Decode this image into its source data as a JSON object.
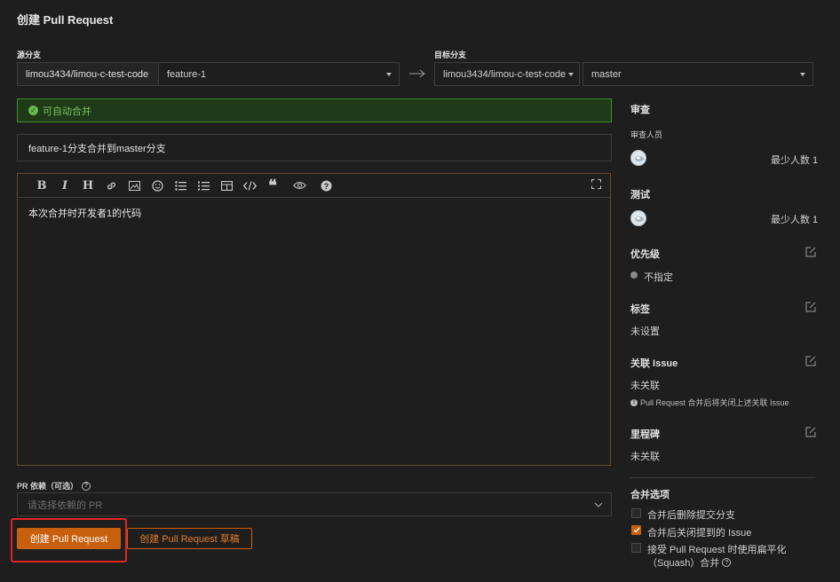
{
  "page": {
    "title": "创建 Pull Request"
  },
  "source": {
    "label": "源分支",
    "repo": "limou3434/limou-c-test-code",
    "branch": "feature-1"
  },
  "target": {
    "label": "目标分支",
    "repo": "limou3434/limou-c-test-code",
    "branch": "master"
  },
  "merge_status": {
    "text": "可自动合并",
    "color": "#74c45b"
  },
  "form": {
    "title_value": "feature-1分支合并到master分支",
    "body_value": "本次合并时开发者1的代码",
    "dependency_label": "PR 依赖（可选）",
    "dependency_placeholder": "请选择依赖的 PR"
  },
  "toolbar": [
    "bold-icon",
    "italic-icon",
    "heading-icon",
    "link-icon",
    "image-icon",
    "emoji-icon",
    "bullet-list-icon",
    "numbered-list-icon",
    "table-icon",
    "code-icon",
    "quote-icon",
    "preview-icon",
    "help-icon",
    "fullscreen-icon"
  ],
  "buttons": {
    "create": "创建 Pull Request",
    "create_draft": "创建 Pull Request 草稿"
  },
  "sidebar": {
    "review": {
      "heading": "审查",
      "sub": "审查人员",
      "min": "最少人数 1"
    },
    "test": {
      "heading": "测试",
      "min": "最少人数 1"
    },
    "priority": {
      "heading": "优先级",
      "value": "不指定"
    },
    "labels": {
      "heading": "标签",
      "value": "未设置"
    },
    "issue": {
      "heading": "关联 Issue",
      "value": "未关联",
      "note": "Pull Request 合并后将关闭上述关联 Issue"
    },
    "milestone": {
      "heading": "里程碑",
      "value": "未关联"
    },
    "merge_options": {
      "heading": "合并选项",
      "opt1": "合并后删除提交分支",
      "opt2": "合并后关闭提到的 Issue",
      "opt3a": "接受 Pull Request 时使用扁平化",
      "opt3b": "（Squash）合并"
    }
  },
  "colors": {
    "accent": "#c75f0d",
    "success_border": "#3f8f2f",
    "highlight": "#e02424"
  }
}
